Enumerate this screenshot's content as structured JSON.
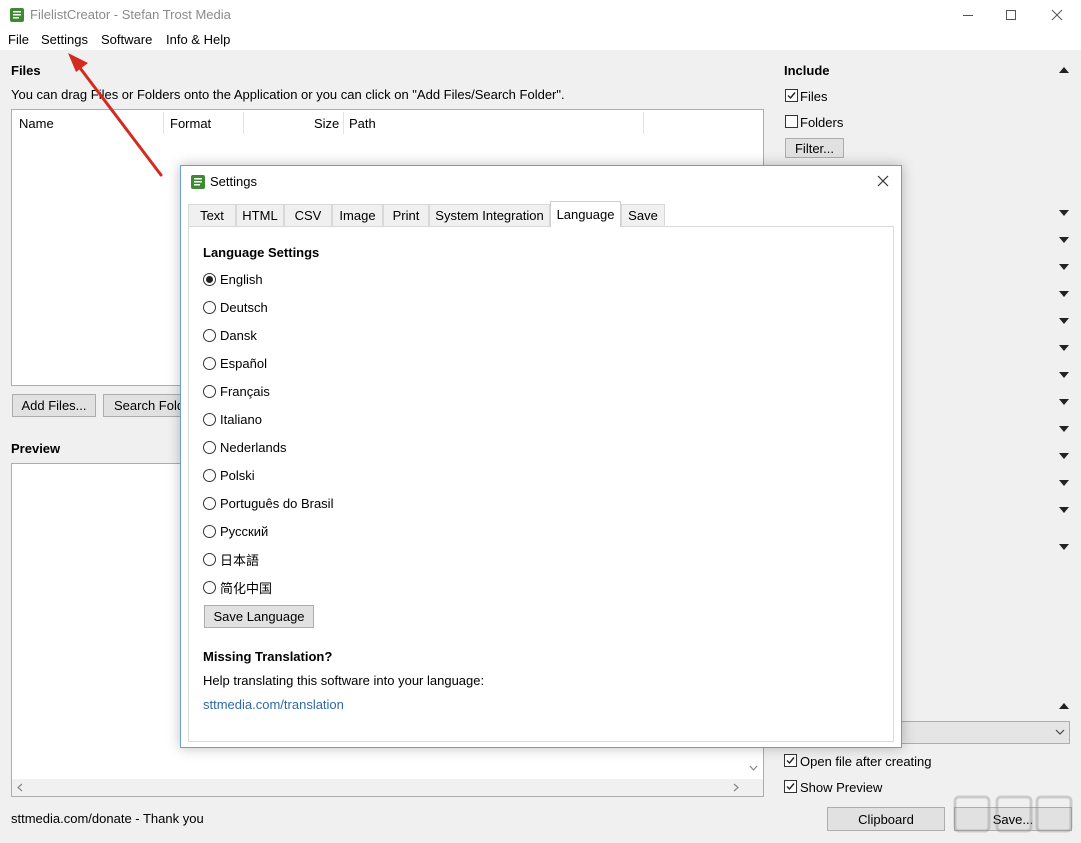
{
  "window": {
    "title": "FilelistCreator - Stefan Trost Media"
  },
  "menu": {
    "items": [
      "File",
      "Settings",
      "Software",
      "Info & Help"
    ]
  },
  "files": {
    "heading": "Files",
    "hint": "You can drag Files or Folders onto the Application or you can click on \"Add Files/Search Folder\".",
    "columns": [
      "Name",
      "Format",
      "Size",
      "Path"
    ],
    "add_files_label": "Add Files...",
    "search_folder_label": "Search Folder..."
  },
  "preview": {
    "heading": "Preview"
  },
  "include": {
    "heading": "Include",
    "files_label": "Files",
    "files_checked": true,
    "folders_label": "Folders",
    "folders_checked": false,
    "filter_label": "Filter..."
  },
  "options": {
    "open_after_label": "Open file after creating",
    "open_after_checked": true,
    "show_preview_label": "Show Preview",
    "show_preview_checked": true,
    "clipboard_label": "Clipboard",
    "save_label": "Save..."
  },
  "status": {
    "text": "sttmedia.com/donate - Thank you"
  },
  "dialog": {
    "title": "Settings",
    "tabs": [
      "Text",
      "HTML",
      "CSV",
      "Image",
      "Print",
      "System Integration",
      "Language",
      "Save"
    ],
    "active_tab": "Language",
    "language_heading": "Language Settings",
    "languages": [
      "English",
      "Deutsch",
      "Dansk",
      "Español",
      "Français",
      "Italiano",
      "Nederlands",
      "Polski",
      "Português do Brasil",
      "Русский",
      "日本語",
      "简化中国"
    ],
    "selected_language": "English",
    "save_language_label": "Save Language",
    "missing_heading": "Missing Translation?",
    "missing_text": "Help translating this software into your language:",
    "missing_link": "sttmedia.com/translation"
  },
  "colors": {
    "accent_arrow": "#d42a1f",
    "link": "#2f6aa8",
    "dialog_border": "#6a9fd4"
  }
}
